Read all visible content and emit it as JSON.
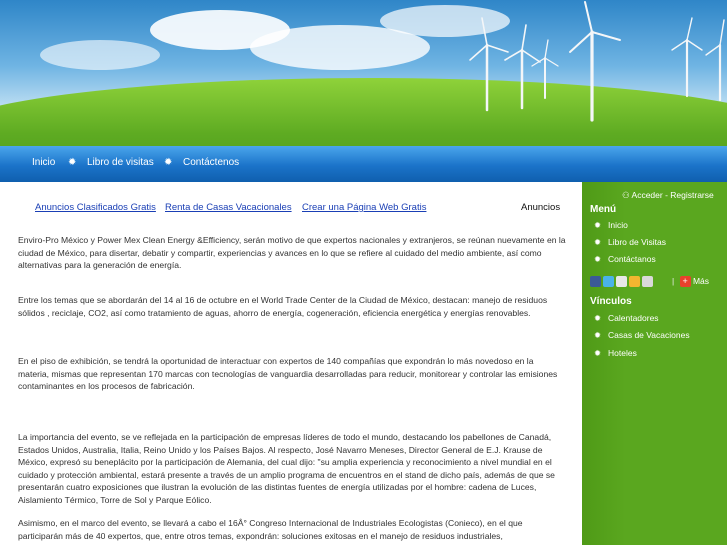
{
  "nav": {
    "items": [
      "Inicio",
      "Libro de visitas",
      "Contáctenos"
    ]
  },
  "ads": {
    "links": [
      "Anuncios Clasificados Gratis",
      "Renta de Casas Vacacionales",
      "Crear una Página Web Gratis"
    ],
    "label": "Anuncios"
  },
  "article": {
    "p1": "Enviro-Pro México y Power Mex Clean Energy &Efficiency, serán motivo de que expertos nacionales y extranjeros, se reúnan nuevamente en la ciudad de México, para disertar, debatir y compartir, experiencias y avances en lo que se refiere al cuidado del medio ambiente, así como alternativas para la generación de energía.",
    "p2": "Entre los temas que se abordarán del 14 al 16 de octubre en el World Trade Center de la Ciudad de México, destacan: manejo de residuos sólidos , reciclaje, CO2, así como tratamiento de aguas, ahorro de energía, cogeneración, eficiencia energética y energías renovables.",
    "p3": "En el piso de exhibición, se tendrá la oportunidad de interactuar con expertos de 140 compañías que expondrán lo más novedoso en la materia, mismas que representan 170 marcas con tecnologías de vanguardia desarrolladas para reducir, monitorear y controlar las emisiones contaminantes en los procesos de fabricación.",
    "p4": " La importancia del evento, se ve reflejada en la participación de empresas líderes de todo el mundo, destacando los pabellones de Canadá, Estados Unidos, Australia, Italia, Reino Unido y los Países Bajos. Al respecto, José Navarro Meneses, Director General de E.J. Krause de México, expresó su beneplácito por la participación de Alemania, del cual dijo: \"su amplia experiencia y reconocimiento a nivel mundial en el cuidado y protección ambiental, estará presente a través de un amplio programa de encuentros en el stand de dicho país, además de que se presentarán cuatro exposiciones que ilustran la evolución de las distintas fuentes de energía utilizadas por el hombre: cadena de Luces, Aislamiento Térmico, Torre de Sol y Parque Eólico.",
    "p5": "Asimismo, en el marco del evento, se llevará a cabo el 16Â° Congreso Internacional de Industriales Ecologistas (Conieco), en el que participarán más de 40 expertos, que, entre otros temas, expondrán: soluciones exitosas en el manejo de residuos industriales,"
  },
  "sidebar": {
    "login": "Acceder - Registrarse",
    "menu_title": "Menú",
    "menu_items": [
      "Inicio",
      "Libro de Visitas",
      "Contáctanos"
    ],
    "more": "Más",
    "links_title": "Vínculos",
    "link_items": [
      "Calentadores",
      "Casas de Vacaciones",
      "Hoteles"
    ]
  },
  "colors": {
    "nav_blue": "#1b73c9",
    "sidebar_green": "#5aa71f",
    "link_blue": "#1a3fb5"
  }
}
